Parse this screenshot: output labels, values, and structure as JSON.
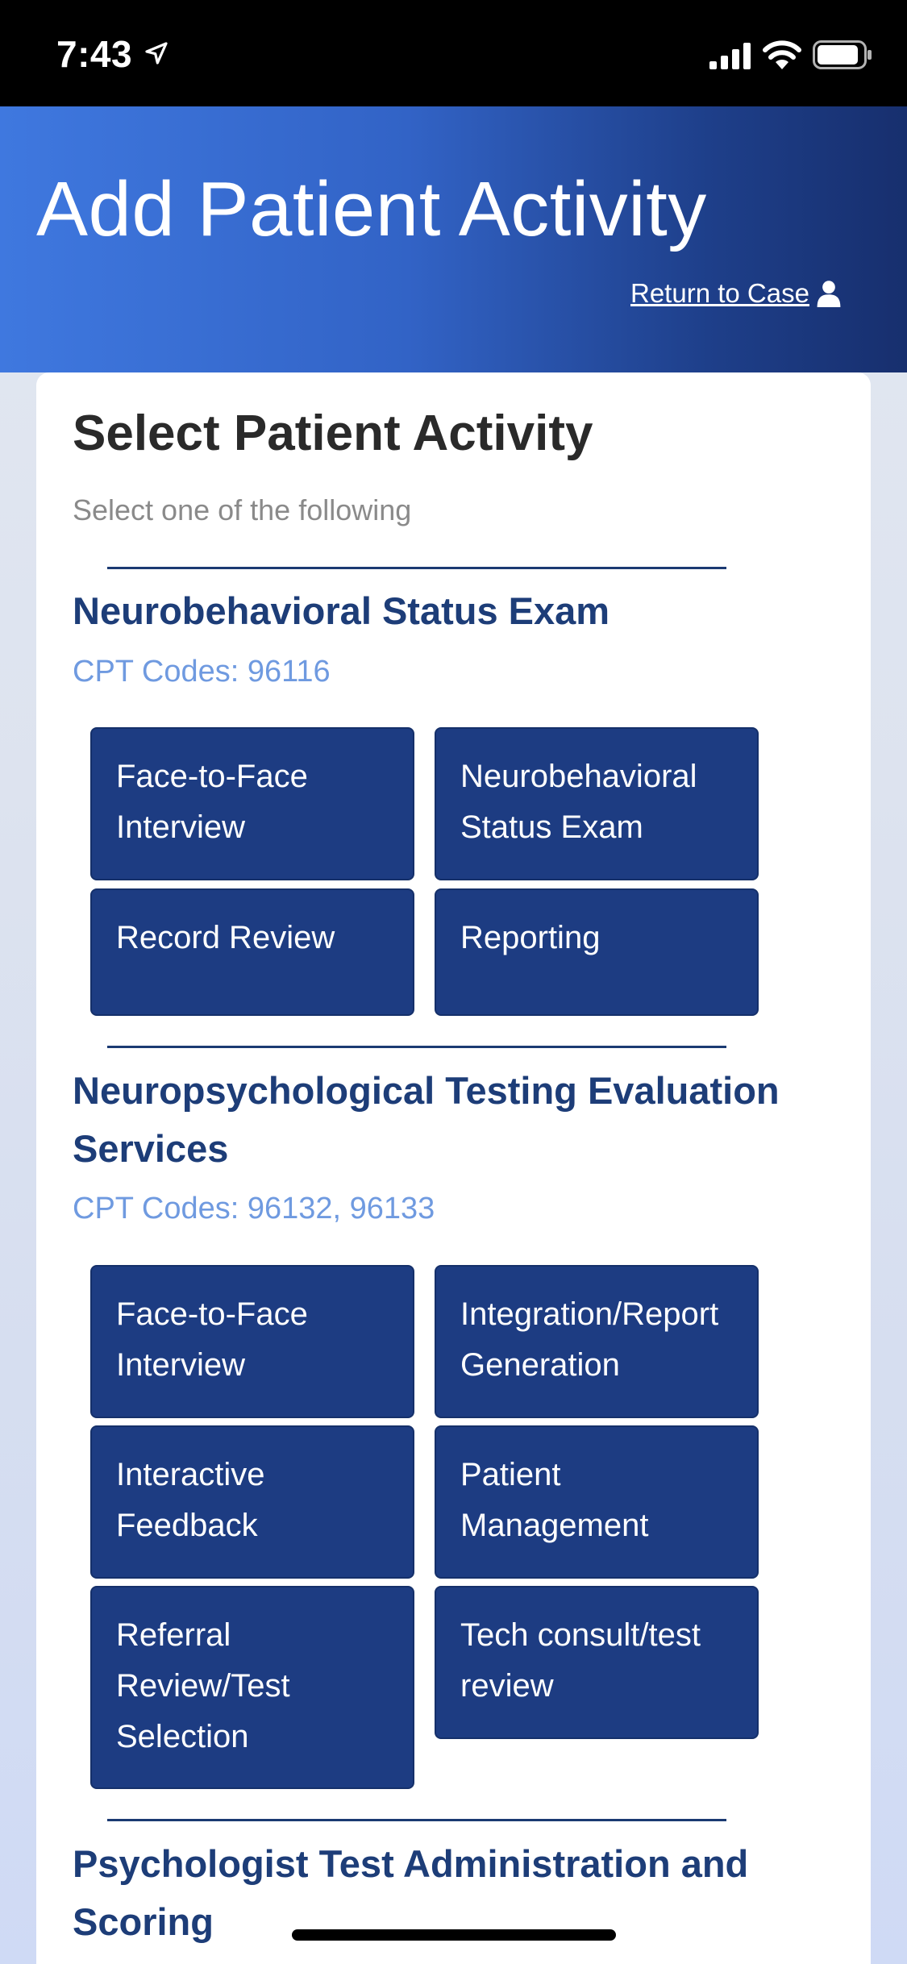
{
  "status_bar": {
    "time": "7:43"
  },
  "header": {
    "title": "Add Patient Activity",
    "return_link": "Return to Case"
  },
  "card": {
    "title": "Select Patient Activity",
    "subtitle": "Select one of the following"
  },
  "sections": [
    {
      "title": "Neurobehavioral Status Exam",
      "cpt": "CPT Codes: 96116",
      "buttons": [
        "Face-to-Face Interview",
        "Neurobehavioral Status Exam",
        "Record Review",
        "Reporting"
      ]
    },
    {
      "title": "Neuropsychological Testing Evaluation Services",
      "cpt": "CPT Codes: 96132, 96133",
      "buttons": [
        "Face-to-Face Interview",
        "Integration/Report Generation",
        "Interactive Feedback",
        "Patient Management",
        "Referral Review/Test Selection",
        "Tech consult/test review"
      ]
    },
    {
      "title": "Psychologist Test Administration and Scoring"
    }
  ],
  "colors": {
    "header_start": "#3f78df",
    "header_end": "#172f6e",
    "button_bg": "#1d3c82",
    "section_title": "#1d3d78",
    "cpt_text": "#6f9ae0"
  }
}
